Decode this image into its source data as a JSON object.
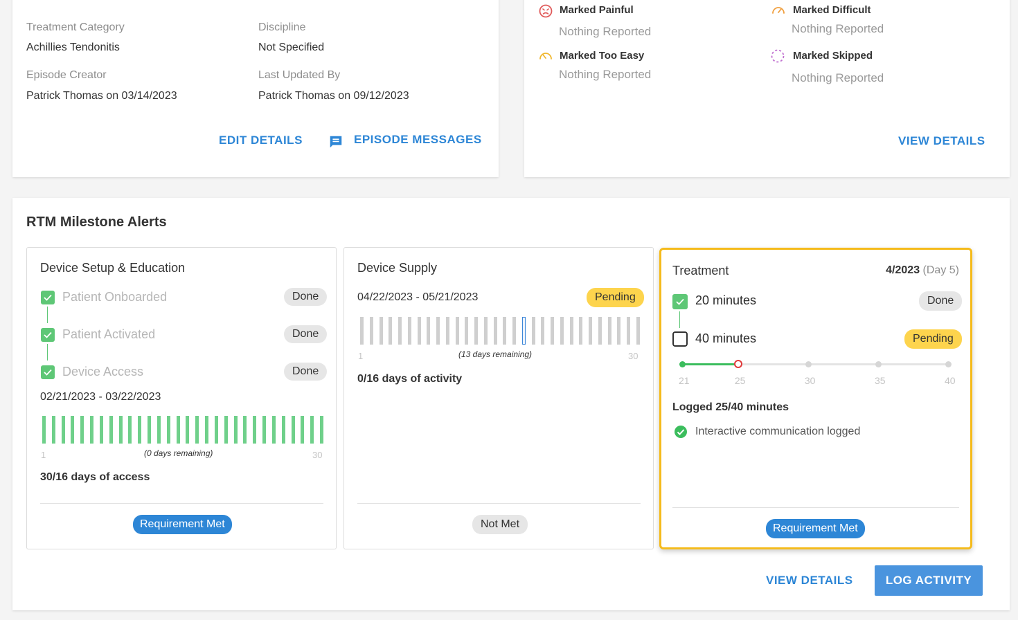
{
  "episode": {
    "treatment_category_label": "Treatment Category",
    "treatment_category_value": "Achillies Tendonitis",
    "discipline_label": "Discipline",
    "discipline_value": "Not Specified",
    "episode_creator_label": "Episode Creator",
    "episode_creator_value": "Patrick Thomas on 03/14/2023",
    "last_updated_label": "Last Updated By",
    "last_updated_value": "Patrick Thomas on 09/12/2023",
    "edit_details": "EDIT DETAILS",
    "episode_messages": "EPISODE MESSAGES"
  },
  "feedback": {
    "painful_label": "Marked Painful",
    "painful_value": "Nothing Reported",
    "difficult_label": "Marked Difficult",
    "difficult_value": "Nothing Reported",
    "too_easy_label": "Marked Too Easy",
    "too_easy_value": "Nothing Reported",
    "skipped_label": "Marked Skipped",
    "skipped_value": "Nothing Reported",
    "view_details": "VIEW DETAILS",
    "colors": {
      "painful": "#e05a5a",
      "difficult": "#f0a040",
      "too_easy": "#f0b830",
      "skipped": "#c070d0"
    }
  },
  "rtm": {
    "title": "RTM Milestone Alerts",
    "view_details": "VIEW DETAILS",
    "log_activity": "LOG ACTIVITY",
    "device_setup": {
      "title": "Device Setup & Education",
      "steps": [
        {
          "label": "Patient Onboarded",
          "status": "Done"
        },
        {
          "label": "Patient Activated",
          "status": "Done"
        },
        {
          "label": "Device Access",
          "status": "Done"
        }
      ],
      "date_range": "02/21/2023 - 03/22/2023",
      "axis_start": "1",
      "axis_end": "30",
      "remaining": "(0 days remaining)",
      "days_total": 30,
      "days_active": 30,
      "stat": "30/16 days of access",
      "requirement": "Requirement Met"
    },
    "device_supply": {
      "title": "Device Supply",
      "date_range": "04/22/2023 - 05/21/2023",
      "status": "Pending",
      "axis_start": "1",
      "axis_end": "30",
      "remaining": "(13 days remaining)",
      "days_total": 30,
      "current_day": 18,
      "stat": "0/16 days of activity",
      "requirement": "Not Met"
    },
    "treatment": {
      "title": "Treatment",
      "period": "4/2023",
      "day": "(Day 5)",
      "steps": [
        {
          "label": "20 minutes",
          "status": "Done",
          "checked": true
        },
        {
          "label": "40 minutes",
          "status": "Pending",
          "checked": false
        }
      ],
      "ticks": [
        "21",
        "25",
        "30",
        "35",
        "40"
      ],
      "progress_minutes": 25,
      "goal_minutes": 40,
      "logged": "Logged 25/40 minutes",
      "communication": "Interactive communication logged",
      "requirement": "Requirement Met",
      "highlight_color": "#f5bb1c"
    }
  }
}
